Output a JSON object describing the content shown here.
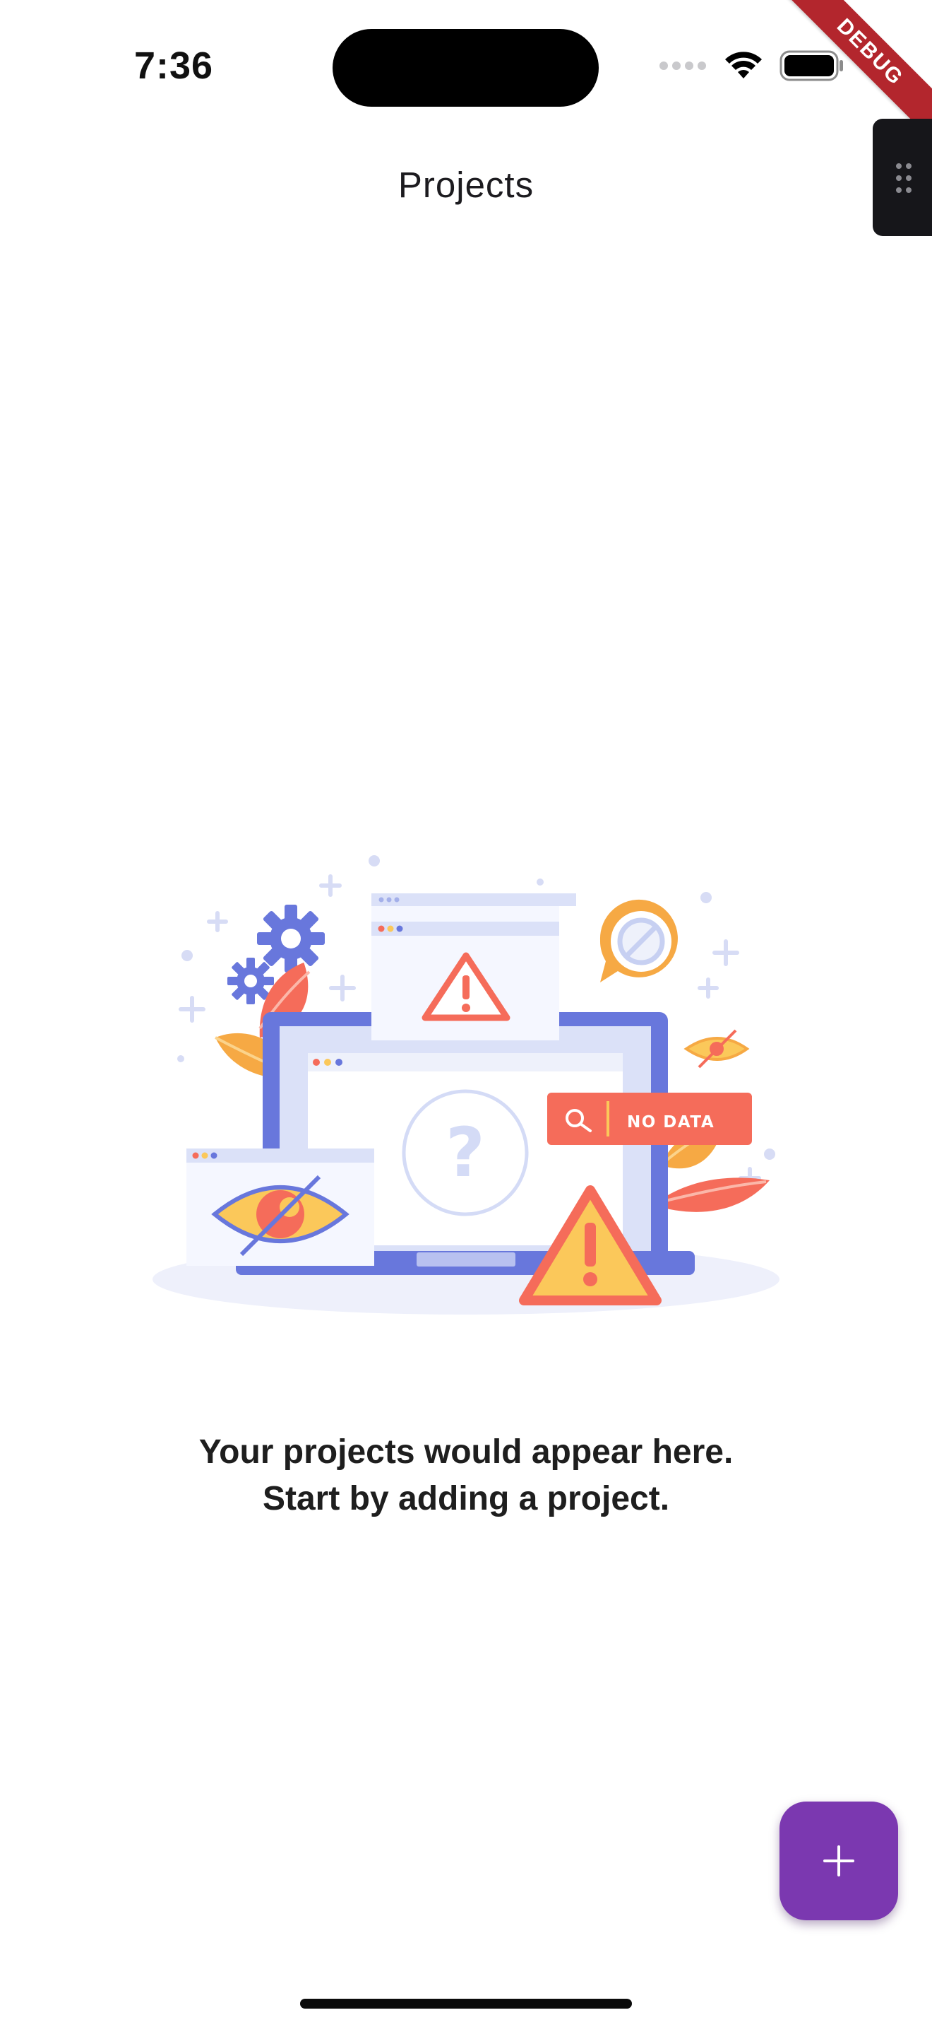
{
  "status_bar": {
    "time": "7:36"
  },
  "debug_banner": {
    "label": "DEBUG"
  },
  "app_bar": {
    "title": "Projects"
  },
  "illustration": {
    "no_data_label": "NO DATA",
    "question_mark": "?"
  },
  "empty_state": {
    "line1": "Your projects would appear here.",
    "line2": "Start by adding a project."
  },
  "fab": {
    "icon": "plus-icon"
  },
  "colors": {
    "fab_background": "#7b38b0",
    "debug_banner": "#b3262d",
    "illustration_blue": "#6877dc",
    "illustration_coral": "#f56c5a",
    "illustration_yellow": "#fbc85a",
    "illustration_orange": "#f5a54a"
  }
}
